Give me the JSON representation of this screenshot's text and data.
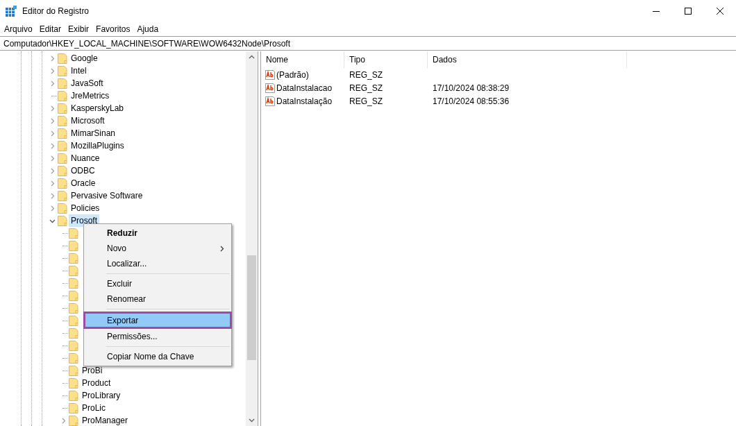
{
  "window": {
    "title": "Editor do Registro"
  },
  "menu": [
    "Arquivo",
    "Editar",
    "Exibir",
    "Favoritos",
    "Ajuda"
  ],
  "address": "Computador\\HKEY_LOCAL_MACHINE\\SOFTWARE\\WOW6432Node\\Prosoft",
  "tree": [
    {
      "label": "Google",
      "expandable": true,
      "expanded": false,
      "selected": false
    },
    {
      "label": "Intel",
      "expandable": true,
      "expanded": false,
      "selected": false
    },
    {
      "label": "JavaSoft",
      "expandable": true,
      "expanded": false,
      "selected": false
    },
    {
      "label": "JreMetrics",
      "expandable": false,
      "selected": false
    },
    {
      "label": "KasperskyLab",
      "expandable": true,
      "expanded": false,
      "selected": false
    },
    {
      "label": "Microsoft",
      "expandable": true,
      "expanded": false,
      "selected": false
    },
    {
      "label": "MimarSinan",
      "expandable": true,
      "expanded": false,
      "selected": false
    },
    {
      "label": "MozillaPlugins",
      "expandable": true,
      "expanded": false,
      "selected": false
    },
    {
      "label": "Nuance",
      "expandable": true,
      "expanded": false,
      "selected": false
    },
    {
      "label": "ODBC",
      "expandable": true,
      "expanded": false,
      "selected": false
    },
    {
      "label": "Oracle",
      "expandable": true,
      "expanded": false,
      "selected": false
    },
    {
      "label": "Pervasive Software",
      "expandable": true,
      "expanded": false,
      "selected": false
    },
    {
      "label": "Policies",
      "expandable": true,
      "expanded": false,
      "selected": false
    },
    {
      "label": "Prosoft",
      "expandable": true,
      "expanded": true,
      "selected": true,
      "children": [
        {
          "expandable": false
        },
        {
          "expandable": false
        },
        {
          "expandable": false
        },
        {
          "expandable": false
        },
        {
          "expandable": false
        },
        {
          "expandable": false
        },
        {
          "expandable": false
        },
        {
          "expandable": false
        },
        {
          "expandable": false
        },
        {
          "expandable": false
        },
        {
          "expandable": false
        },
        {
          "label": "ProBi",
          "expandable": false,
          "selected": false
        },
        {
          "label": "Product",
          "expandable": false,
          "selected": false
        },
        {
          "label": "ProLibrary",
          "expandable": false,
          "selected": false
        },
        {
          "label": "ProLic",
          "expandable": false,
          "selected": false
        },
        {
          "label": "ProManager",
          "expandable": true,
          "expanded": false,
          "selected": false
        }
      ]
    }
  ],
  "table": {
    "columns": [
      "Nome",
      "Tipo",
      "Dados"
    ],
    "rows": [
      {
        "name": "(Padrão)",
        "type": "REG_SZ"
      },
      {
        "name": "DataInstalacao",
        "type": "REG_SZ",
        "data": "17/10/2024 08:38:29"
      },
      {
        "name": "DataInstalação",
        "type": "REG_SZ",
        "data": "17/10/2024 08:55:36"
      }
    ]
  },
  "context_menu": [
    {
      "kind": "item",
      "label": "Reduzir",
      "bold": true,
      "submenu": false,
      "selected": false
    },
    {
      "kind": "item",
      "label": "Novo",
      "bold": false,
      "submenu": true,
      "selected": false
    },
    {
      "kind": "item",
      "label": "Localizar...",
      "bold": false,
      "submenu": false,
      "selected": false
    },
    {
      "kind": "separator"
    },
    {
      "kind": "item",
      "label": "Excluir",
      "bold": false,
      "submenu": false,
      "selected": false
    },
    {
      "kind": "item",
      "label": "Renomear",
      "bold": false,
      "submenu": false,
      "selected": false
    },
    {
      "kind": "separator"
    },
    {
      "kind": "item",
      "label": "Exportar",
      "bold": false,
      "submenu": false,
      "selected": true
    },
    {
      "kind": "item",
      "label": "Permissões...",
      "bold": false,
      "submenu": false,
      "selected": false
    },
    {
      "kind": "separator"
    },
    {
      "kind": "item",
      "label": "Copiar Nome da Chave",
      "bold": false,
      "submenu": false,
      "selected": false
    }
  ]
}
